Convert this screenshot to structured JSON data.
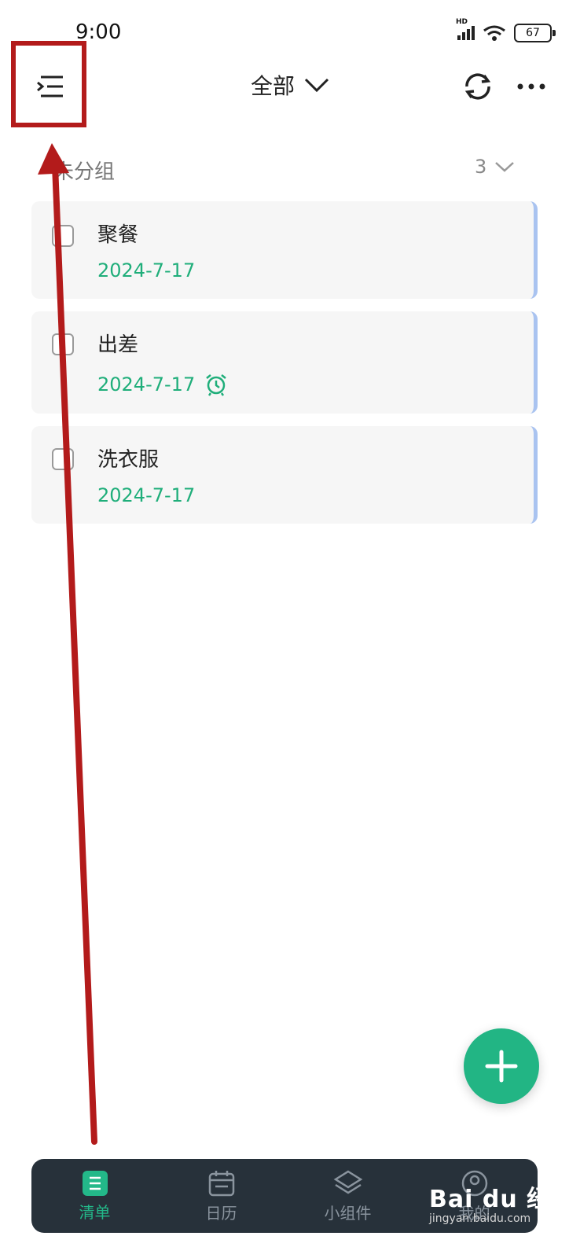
{
  "status_bar": {
    "time": "9:00",
    "network_label": "HD",
    "battery": "67"
  },
  "header": {
    "title": "全部",
    "icons": {
      "menu": "menu-indent-icon",
      "dropdown": "chevron-down-icon",
      "sync": "sync-icon",
      "more": "more-horizontal-icon"
    }
  },
  "group": {
    "label": "未分组",
    "count": "3"
  },
  "tasks": [
    {
      "title": "聚餐",
      "date": "2024-7-17",
      "has_alarm": false
    },
    {
      "title": "出差",
      "date": "2024-7-17",
      "has_alarm": true
    },
    {
      "title": "洗衣服",
      "date": "2024-7-17",
      "has_alarm": false
    }
  ],
  "bottom_nav": [
    {
      "label": "清单",
      "icon": "list-icon",
      "active": true
    },
    {
      "label": "日历",
      "icon": "calendar-icon",
      "active": false
    },
    {
      "label": "小组件",
      "icon": "layers-icon",
      "active": false
    },
    {
      "label": "我的",
      "icon": "profile-icon",
      "active": false
    }
  ],
  "watermark": {
    "brand": "Bai du 经验",
    "url": "jingyan.baidu.com"
  },
  "colors": {
    "accent_green": "#1fae7a",
    "annotation_red": "#b31b1b",
    "card_edge_blue": "#a9c3f0",
    "nav_background": "#27313a"
  }
}
